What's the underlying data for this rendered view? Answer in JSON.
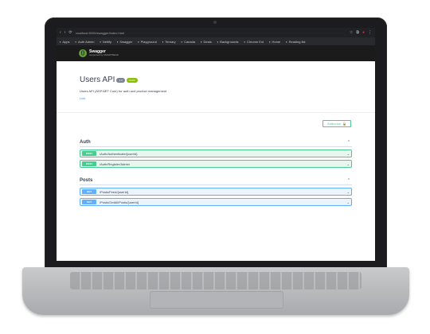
{
  "browser": {
    "url": "localhost:5000/swagger/index.html",
    "bookmarks": [
      "Apps",
      "Auth Admin",
      "Netlify",
      "Swagger",
      "Playground",
      "Ternary",
      "Canada",
      "Deals",
      "Backgrounds",
      "Chrome Ext",
      "Home",
      "Reading list"
    ]
  },
  "swagger": {
    "brand": "Swagger",
    "brand_sub": "supported by SMARTBEAR",
    "title": "Users API",
    "version_badge": "1.0",
    "oas_badge": "OAS3",
    "description": "Users API (ASP.NET Core) for auth and product management",
    "link": "Link",
    "authorize": "Authorize"
  },
  "sections": [
    {
      "name": "Auth",
      "ops": [
        {
          "method": "POST",
          "path": "/Auth/Authenticate/{userId}"
        },
        {
          "method": "POST",
          "path": "/Auth/Register/Admin"
        }
      ]
    },
    {
      "name": "Posts",
      "ops": [
        {
          "method": "GET",
          "path": "/Posts/Feed/{userId}"
        },
        {
          "method": "GET",
          "path": "/Posts/GetAll/Posts/{userId}"
        }
      ]
    }
  ],
  "colors": {
    "post": "#49cc90",
    "get": "#61affe",
    "oas": "#89bf04"
  },
  "icons": {
    "lock": "lock-icon",
    "chevron": "chevron-icon"
  }
}
